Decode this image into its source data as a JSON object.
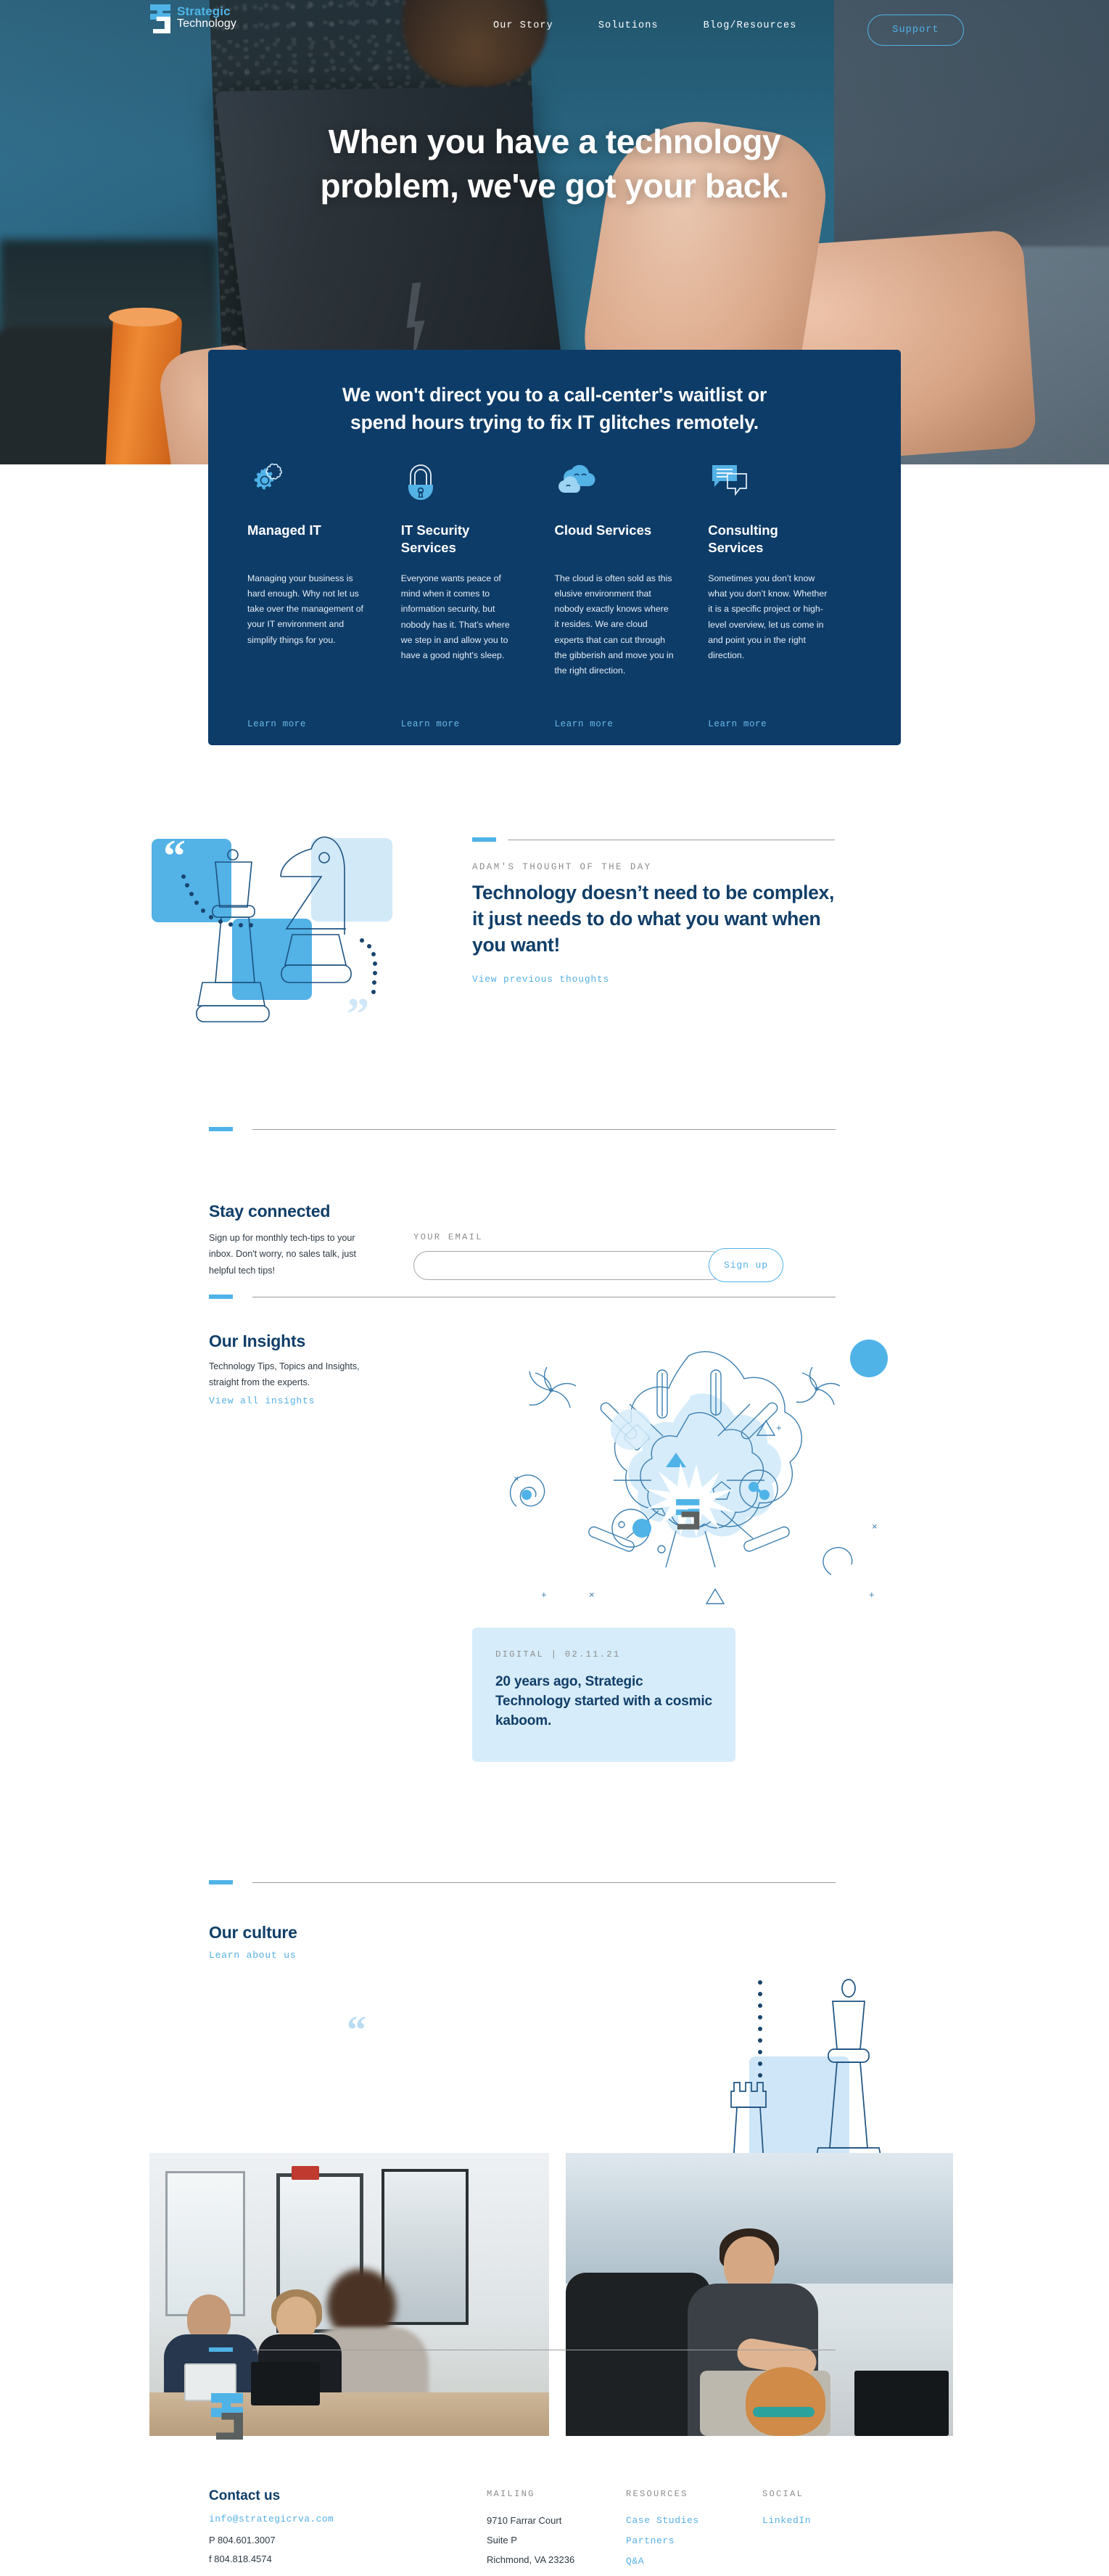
{
  "nav": {
    "logo_line1": "Strategic",
    "logo_line2": "Technology",
    "links": [
      {
        "label": "Our Story"
      },
      {
        "label": "Solutions"
      },
      {
        "label": "Blog/Resources"
      }
    ],
    "support_label": "Support"
  },
  "hero": {
    "title_line1": "When you have a technology",
    "title_line2": "problem, we've got your back."
  },
  "services": {
    "headline_line1": "We won't direct you to a call-center's waitlist or",
    "headline_line2": "spend hours trying to fix IT glitches remotely.",
    "card_bg": "#0e3c68",
    "items": [
      {
        "icon": "gear-icon",
        "title": "Managed IT",
        "body": "Managing your business is hard enough. Why not let us take over the management of your IT environment and simplify things for you.",
        "link": "Learn more"
      },
      {
        "icon": "lock-icon",
        "title": "IT Security Services",
        "body": "Everyone wants peace of mind when it comes to information security, but nobody has it. That’s where we step in and allow you to have a good night's sleep.",
        "link": "Learn more"
      },
      {
        "icon": "cloud-icon",
        "title": "Cloud Services",
        "body": "The cloud is often sold as this elusive environment that nobody exactly knows where it resides. We are cloud experts that can cut through the gibberish and move you in the right direction.",
        "link": "Learn more"
      },
      {
        "icon": "chat-bubbles-icon",
        "title": "Consulting Services",
        "body": "Sometimes you don’t know what you don’t know. Whether it is a specific project or high-level overview, let us come in and point you in the right direction.",
        "link": "Learn more"
      }
    ]
  },
  "thought": {
    "eyebrow": "ADAM'S THOUGHT OF THE DAY",
    "quote": "Technology doesn’t need to be complex, it just needs to do what you want when you want!",
    "link": "View previous thoughts"
  },
  "stay_connected": {
    "heading": "Stay connected",
    "body": "Sign up for monthly tech-tips to your inbox. Don't worry, no sales talk, just helpful tech tips!",
    "field_label": "YOUR EMAIL",
    "field_value": "",
    "field_placeholder": "",
    "button_label": "Sign up"
  },
  "insights": {
    "heading": "Our Insights",
    "body": "Technology Tips, Topics and Insights, straight from the experts.",
    "link": "View all insights",
    "card": {
      "meta": "DIGITAL | 02.11.21",
      "title": "20 years ago, Strategic Technology started with a cosmic kaboom."
    }
  },
  "culture": {
    "heading": "Our culture",
    "link": "Learn about us"
  },
  "footer": {
    "contact_heading": "Contact us",
    "email": "info@strategicrva.com",
    "phone": "P 804.601.3007",
    "fax": "f 804.818.4574",
    "mailing": {
      "heading": "MAILING",
      "line1": "9710 Farrar Court",
      "line2": "Suite P",
      "line3": "Richmond, VA 23236"
    },
    "resources": {
      "heading": "RESOURCES",
      "links": [
        "Case Studies",
        "Partners",
        "Q&A"
      ]
    },
    "social": {
      "heading": "SOCIAL",
      "links": [
        "LinkedIn"
      ]
    }
  },
  "colors": {
    "brand_blue": "#4fb3e8",
    "deep_blue": "#0e3c68",
    "pale_blue": "#d6ecfa"
  }
}
